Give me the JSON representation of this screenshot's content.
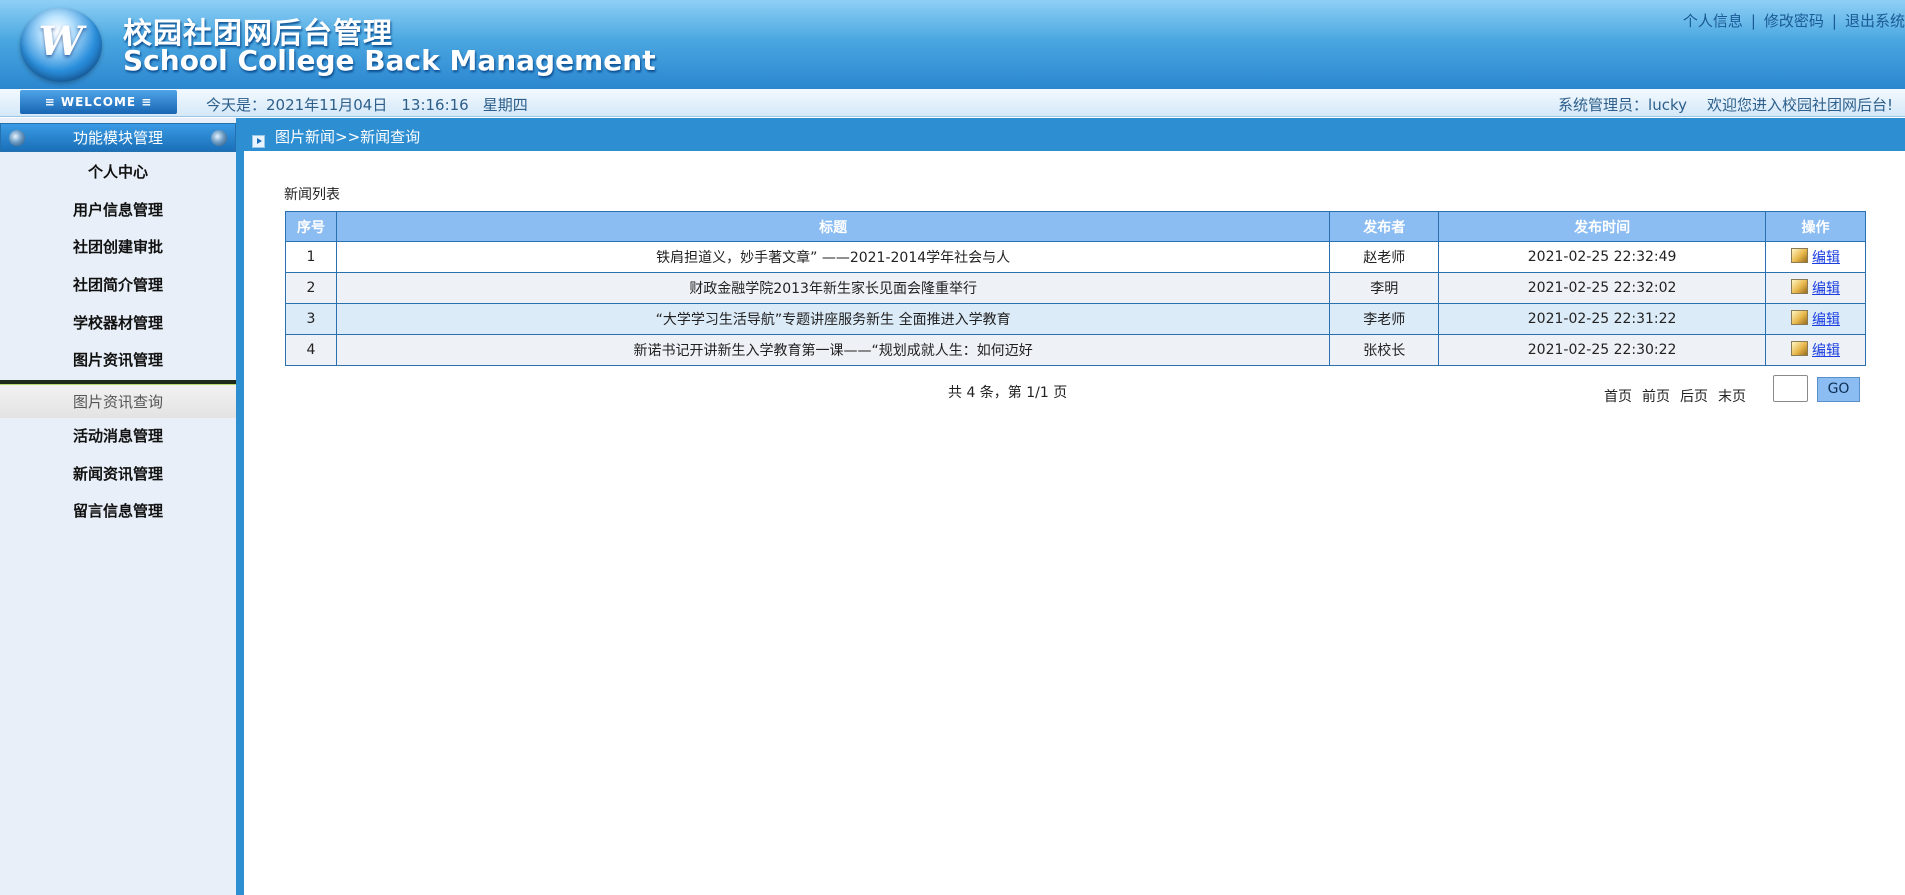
{
  "header": {
    "title_cn": "校园社团网后台管理",
    "title_en": "School College Back Management",
    "logo_letter": "W",
    "links": [
      "个人信息",
      "修改密码",
      "退出系统"
    ],
    "link_separator": "|"
  },
  "infobar": {
    "welcome": "≡ WELCOME ≡",
    "date": "今天是：2021年11月04日",
    "time": "13:16:16",
    "weekday": "星期四",
    "admin": "系统管理员：lucky",
    "greeting": "欢迎您进入校园社团网后台!"
  },
  "sidebar": {
    "heading": "功能模块管理",
    "items": [
      {
        "label": "个人中心"
      },
      {
        "label": "用户信息管理"
      },
      {
        "label": "社团创建审批"
      },
      {
        "label": "社团简介管理"
      },
      {
        "label": "学校器材管理"
      },
      {
        "label": "图片资讯管理"
      },
      {
        "label": "图片资讯查询"
      },
      {
        "label": "活动消息管理"
      },
      {
        "label": "新闻资讯管理"
      },
      {
        "label": "留言信息管理"
      }
    ]
  },
  "breadcrumb": "图片新闻>>新闻查询",
  "list_title": "新闻列表",
  "table": {
    "headers": [
      "序号",
      "标题",
      "发布者",
      "发布时间",
      "操作"
    ],
    "rows": [
      {
        "no": "1",
        "title": "铁肩担道义，妙手著文章” ——2021-2014学年社会与人",
        "publisher": "赵老师",
        "time": "2021-02-25 22:32:49",
        "action": "编辑"
      },
      {
        "no": "2",
        "title": "财政金融学院2013年新生家长见面会隆重举行",
        "publisher": "李明",
        "time": "2021-02-25 22:32:02",
        "action": "编辑"
      },
      {
        "no": "3",
        "title": "“大学学习生活导航”专题讲座服务新生 全面推进入学教育",
        "publisher": "李老师",
        "time": "2021-02-25 22:31:22",
        "action": "编辑"
      },
      {
        "no": "4",
        "title": "新诺书记开讲新生入学教育第一课——“规划成就人生：如何迈好",
        "publisher": "张校长",
        "time": "2021-02-25 22:30:22",
        "action": "编辑"
      }
    ]
  },
  "pager": {
    "total_text": "共 4 条，第 1/1 页",
    "first": "首页",
    "prev": "前页",
    "next": "后页",
    "last": "末页",
    "page_input_value": "",
    "go": "GO"
  }
}
